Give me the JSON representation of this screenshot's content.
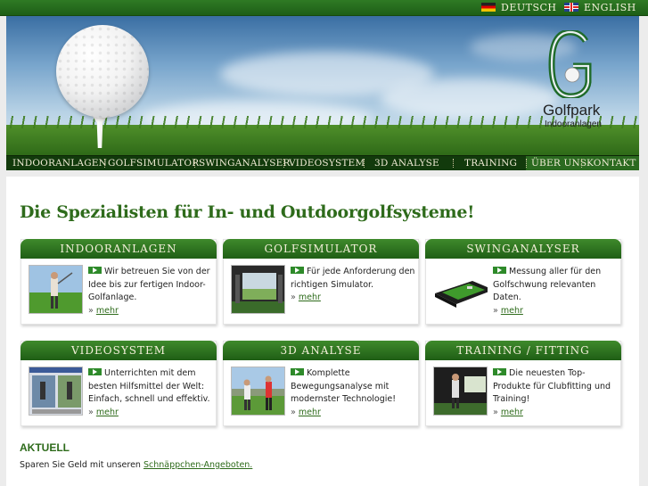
{
  "languages": [
    {
      "label": "DEUTSCH",
      "flag": "german-flag-icon"
    },
    {
      "label": "ENGLISH",
      "flag": "uk-flag-icon"
    }
  ],
  "brand": {
    "name": "Golfpark",
    "subtitle": "Indooranlagen"
  },
  "nav": {
    "items": [
      "INDOORANLAGEN",
      "GOLFSIMULATOR",
      "SWINGANALYSER",
      "VIDEOSYSTEM",
      "3D ANALYSE",
      "TRAINING",
      "ÜBER UNS",
      "KONTAKT"
    ]
  },
  "headline": "Die Spezialisten für In- und Outdoorgolfsysteme!",
  "cards": [
    {
      "title": "INDOORANLAGEN",
      "text": "Wir betreuen Sie von der Idee bis zur fertigen Indoor-Golfanlage.",
      "more": "mehr",
      "image": "indoor-golf-player-image"
    },
    {
      "title": "GOLFSIMULATOR",
      "text": "Für jede Anforderung den richtigen Simulator.",
      "more": "mehr",
      "image": "golf-simulator-image"
    },
    {
      "title": "SWINGANALYSER",
      "text": "Messung aller für den Golfschwung relevanten Daten.",
      "more": "mehr",
      "image": "swing-mat-image"
    },
    {
      "title": "VIDEOSYSTEM",
      "text": "Unterrichten mit dem besten Hilfsmittel der Welt: Einfach, schnell und effektiv.",
      "more": "mehr",
      "image": "video-software-image"
    },
    {
      "title": "3D ANALYSE",
      "text": "Komplette Bewegungsanalyse mit modernster Technologie!",
      "more": "mehr",
      "image": "golfers-outdoor-image"
    },
    {
      "title": "TRAINING / FITTING",
      "text": "Die neuesten Top-Produkte für Clubfitting und Training!",
      "more": "mehr",
      "image": "training-studio-image"
    }
  ],
  "aktuell": {
    "title": "AKTUELL",
    "text": "Sparen Sie Geld mit unseren",
    "link": "Schnäppchen-Angeboten."
  },
  "colors": {
    "brand_green": "#2e6b1b",
    "nav_dark": "#123a0c",
    "accent": "#2e8a2a"
  }
}
